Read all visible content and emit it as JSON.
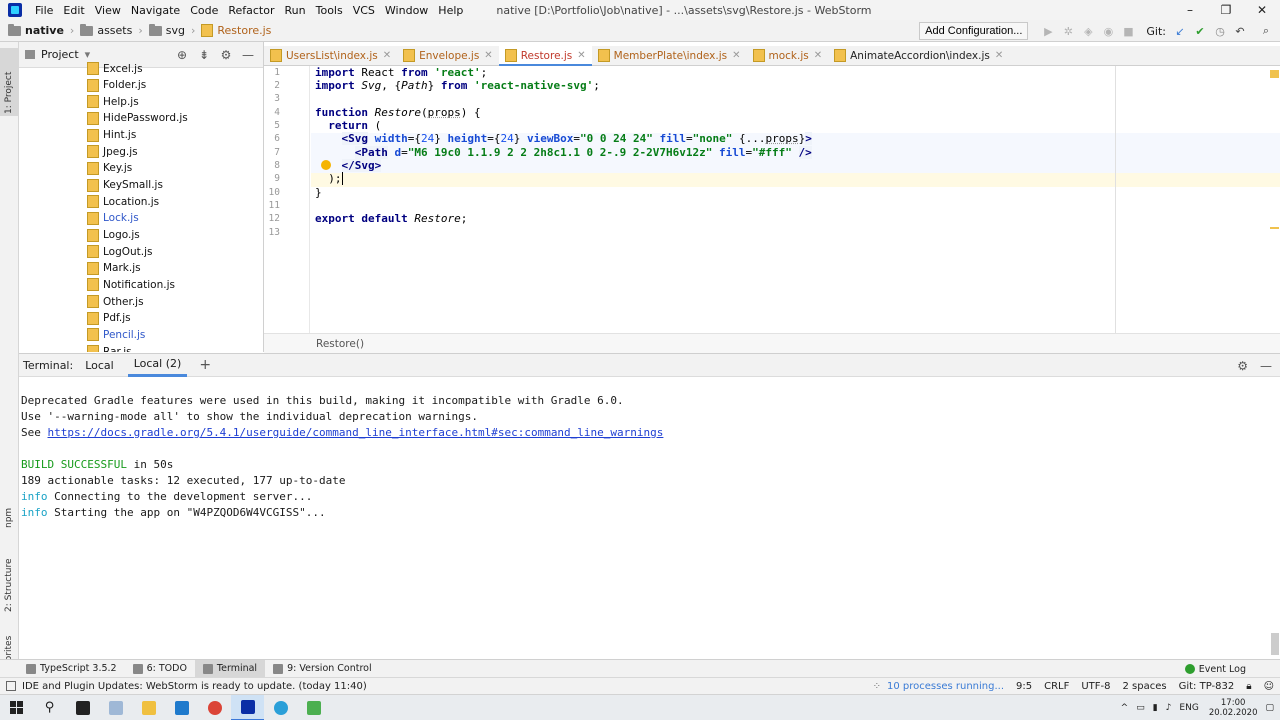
{
  "window": {
    "menu": [
      "File",
      "Edit",
      "View",
      "Navigate",
      "Code",
      "Refactor",
      "Run",
      "Tools",
      "VCS",
      "Window",
      "Help"
    ],
    "title": "native [D:\\Portfolio\\Job\\native] - ...\\assets\\svg\\Restore.js - WebStorm",
    "controls": [
      "–",
      "❐",
      "✕"
    ]
  },
  "navbar": {
    "crumbs": [
      "native",
      "assets",
      "svg",
      "Restore.js"
    ],
    "add_configuration": "Add Configuration...",
    "git_label": "Git:"
  },
  "left_stripe": {
    "project": "1: Project",
    "npm": "npm",
    "structure": "2: Structure",
    "favorites": "2: Favorites"
  },
  "project_panel": {
    "title": "Project",
    "files": [
      {
        "name": "Excel.js",
        "vcs": false
      },
      {
        "name": "Folder.js",
        "vcs": false
      },
      {
        "name": "Help.js",
        "vcs": false
      },
      {
        "name": "HidePassword.js",
        "vcs": false
      },
      {
        "name": "Hint.js",
        "vcs": false
      },
      {
        "name": "Jpeg.js",
        "vcs": false
      },
      {
        "name": "Key.js",
        "vcs": false
      },
      {
        "name": "KeySmall.js",
        "vcs": false
      },
      {
        "name": "Location.js",
        "vcs": false
      },
      {
        "name": "Lock.js",
        "vcs": true
      },
      {
        "name": "Logo.js",
        "vcs": false
      },
      {
        "name": "LogOut.js",
        "vcs": false
      },
      {
        "name": "Mark.js",
        "vcs": false
      },
      {
        "name": "Notification.js",
        "vcs": false
      },
      {
        "name": "Other.js",
        "vcs": false
      },
      {
        "name": "Pdf.js",
        "vcs": false
      },
      {
        "name": "Pencil.js",
        "vcs": true
      },
      {
        "name": "Rar.js",
        "vcs": false
      }
    ]
  },
  "tabs": [
    {
      "label": "UsersList\\index.js",
      "active": false,
      "style": ""
    },
    {
      "label": "Envelope.js",
      "active": false,
      "style": ""
    },
    {
      "label": "Restore.js",
      "active": true,
      "style": "red"
    },
    {
      "label": "MemberPlate\\index.js",
      "active": false,
      "style": ""
    },
    {
      "label": "mock.js",
      "active": false,
      "style": ""
    },
    {
      "label": "AnimateAccordion\\index.js",
      "active": false,
      "style": "plain"
    }
  ],
  "editor": {
    "line_numbers": [
      "1",
      "2",
      "3",
      "4",
      "5",
      "6",
      "7",
      "8",
      "9",
      "10",
      "11",
      "12",
      "13"
    ],
    "breadcrumb": "Restore()"
  },
  "terminal": {
    "label": "Terminal:",
    "tabs": [
      "Local",
      "Local (2)"
    ],
    "lines": {
      "l1": "Deprecated Gradle features were used in this build, making it incompatible with Gradle 6.0.",
      "l2": "Use '--warning-mode all' to show the individual deprecation warnings.",
      "l3_prefix": "See ",
      "l3_link": "https://docs.gradle.org/5.4.1/userguide/command_line_interface.html#sec:command_line_warnings",
      "build_ok": "BUILD SUCCESSFUL",
      "build_time": " in 50s",
      "tasks": "189 actionable tasks: 12 executed, 177 up-to-date",
      "info": "info",
      "info1": " Connecting to the development server...",
      "info2": " Starting the app on \"W4PZQOD6W4VCGISS\"..."
    }
  },
  "bottom_tools": {
    "typescript": "TypeScript 3.5.2",
    "todo": "6: TODO",
    "terminal": "Terminal",
    "vcs": "9: Version Control",
    "event_log": "Event Log"
  },
  "status": {
    "message": "IDE and Plugin Updates: WebStorm is ready to update. (today 11:40)",
    "processes": "10 processes running...",
    "position": "9:5",
    "line_sep": "CRLF",
    "encoding": "UTF-8",
    "indent": "2 spaces",
    "git_branch": "Git: TP-832"
  },
  "taskbar": {
    "lang": "ENG",
    "time": "17:00",
    "date": "20.02.2020"
  }
}
